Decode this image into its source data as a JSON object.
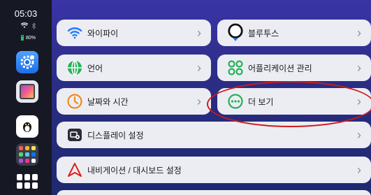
{
  "status": {
    "time": "05:03",
    "wifi_icon": "wifi-icon",
    "bluetooth_icon": "bluetooth-icon",
    "battery_percent": "80%",
    "battery_level": 0.8
  },
  "dock": {
    "apps": [
      "settings-app-icon",
      "gallery-app-icon",
      "penguin-app-icon",
      "color-grid-app-icon",
      "app-grid-icon"
    ]
  },
  "settings": {
    "wifi": {
      "label": "와이파이",
      "icon": "wifi-icon"
    },
    "bluetooth": {
      "label": "블루투스",
      "icon": "bluetooth-icon"
    },
    "language": {
      "label": "언어",
      "icon": "globe-icon"
    },
    "app_management": {
      "label": "어플리케이션 관리",
      "icon": "apps-icon"
    },
    "date_time": {
      "label": "날짜와 시간",
      "icon": "clock-icon"
    },
    "more": {
      "label": "더 보기",
      "icon": "more-icon"
    },
    "display": {
      "label": "디스플레이 설정",
      "icon": "display-settings-icon"
    },
    "navigation_dashboard": {
      "label": "내비게이션 / 대시보드 설정",
      "icon": "navigation-icon"
    }
  },
  "colors": {
    "accent_blue": "#1f7bff",
    "accent_green": "#22b357",
    "accent_orange": "#f08a1c",
    "accent_red": "#e02020",
    "annotation_red": "#d11a1a"
  },
  "chevron": "›"
}
